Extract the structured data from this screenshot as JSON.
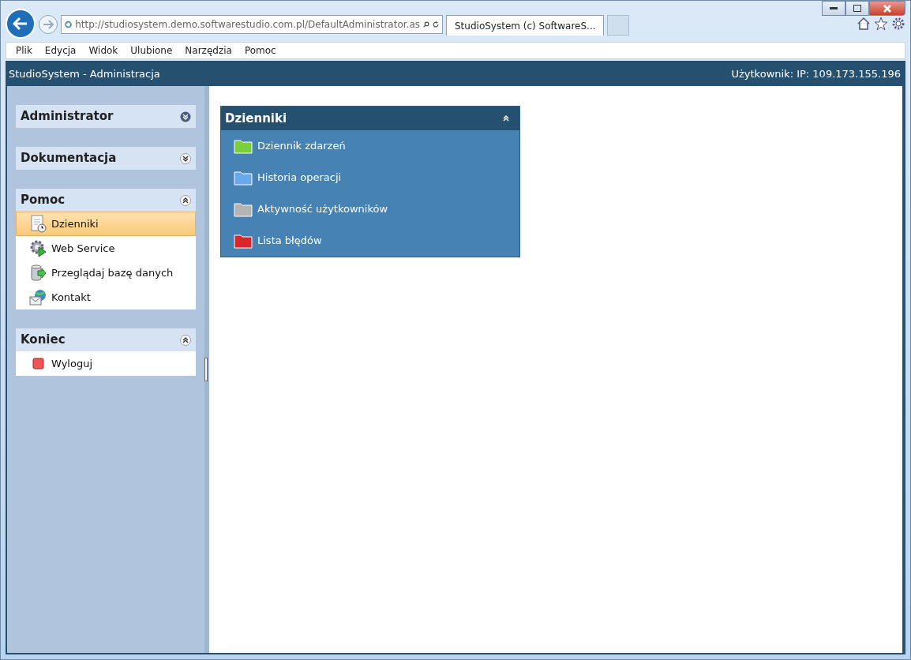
{
  "browser": {
    "address": "http://studiosystem.demo.softwarestudio.com.pl/DefaultAdministrator.as",
    "tab_title": "StudioSystem (c) SoftwareS...",
    "menu": [
      "Plik",
      "Edycja",
      "Widok",
      "Ulubione",
      "Narzędzia",
      "Pomoc"
    ]
  },
  "header": {
    "title": "StudioSystem - Administracja",
    "user": "Użytkownik: IP: 109.173.155.196"
  },
  "sidebar": {
    "sections": [
      {
        "title": "Administrator",
        "expanded": false
      },
      {
        "title": "Dokumentacja",
        "expanded": false
      },
      {
        "title": "Pomoc",
        "expanded": true,
        "items": [
          {
            "label": "Dzienniki",
            "kind": "document",
            "selected": true
          },
          {
            "label": "Web Service",
            "kind": "gear",
            "selected": false
          },
          {
            "label": "Przeglądaj bazę danych",
            "kind": "database",
            "selected": false
          },
          {
            "label": "Kontakt",
            "kind": "mail",
            "selected": false
          }
        ]
      },
      {
        "title": "Koniec",
        "expanded": true,
        "items": [
          {
            "label": "Wyloguj",
            "kind": "stop",
            "selected": false
          }
        ]
      }
    ]
  },
  "panel": {
    "title": "Dzienniki",
    "expanded": true,
    "items": [
      {
        "label": "Dziennik zdarzeń",
        "color": "#7ad03a"
      },
      {
        "label": "Historia operacji",
        "color": "#6aa8ec"
      },
      {
        "label": "Aktywność użytkowników",
        "color": "#b4b4b4"
      },
      {
        "label": "Lista błędów",
        "color": "#d8262a"
      }
    ]
  }
}
